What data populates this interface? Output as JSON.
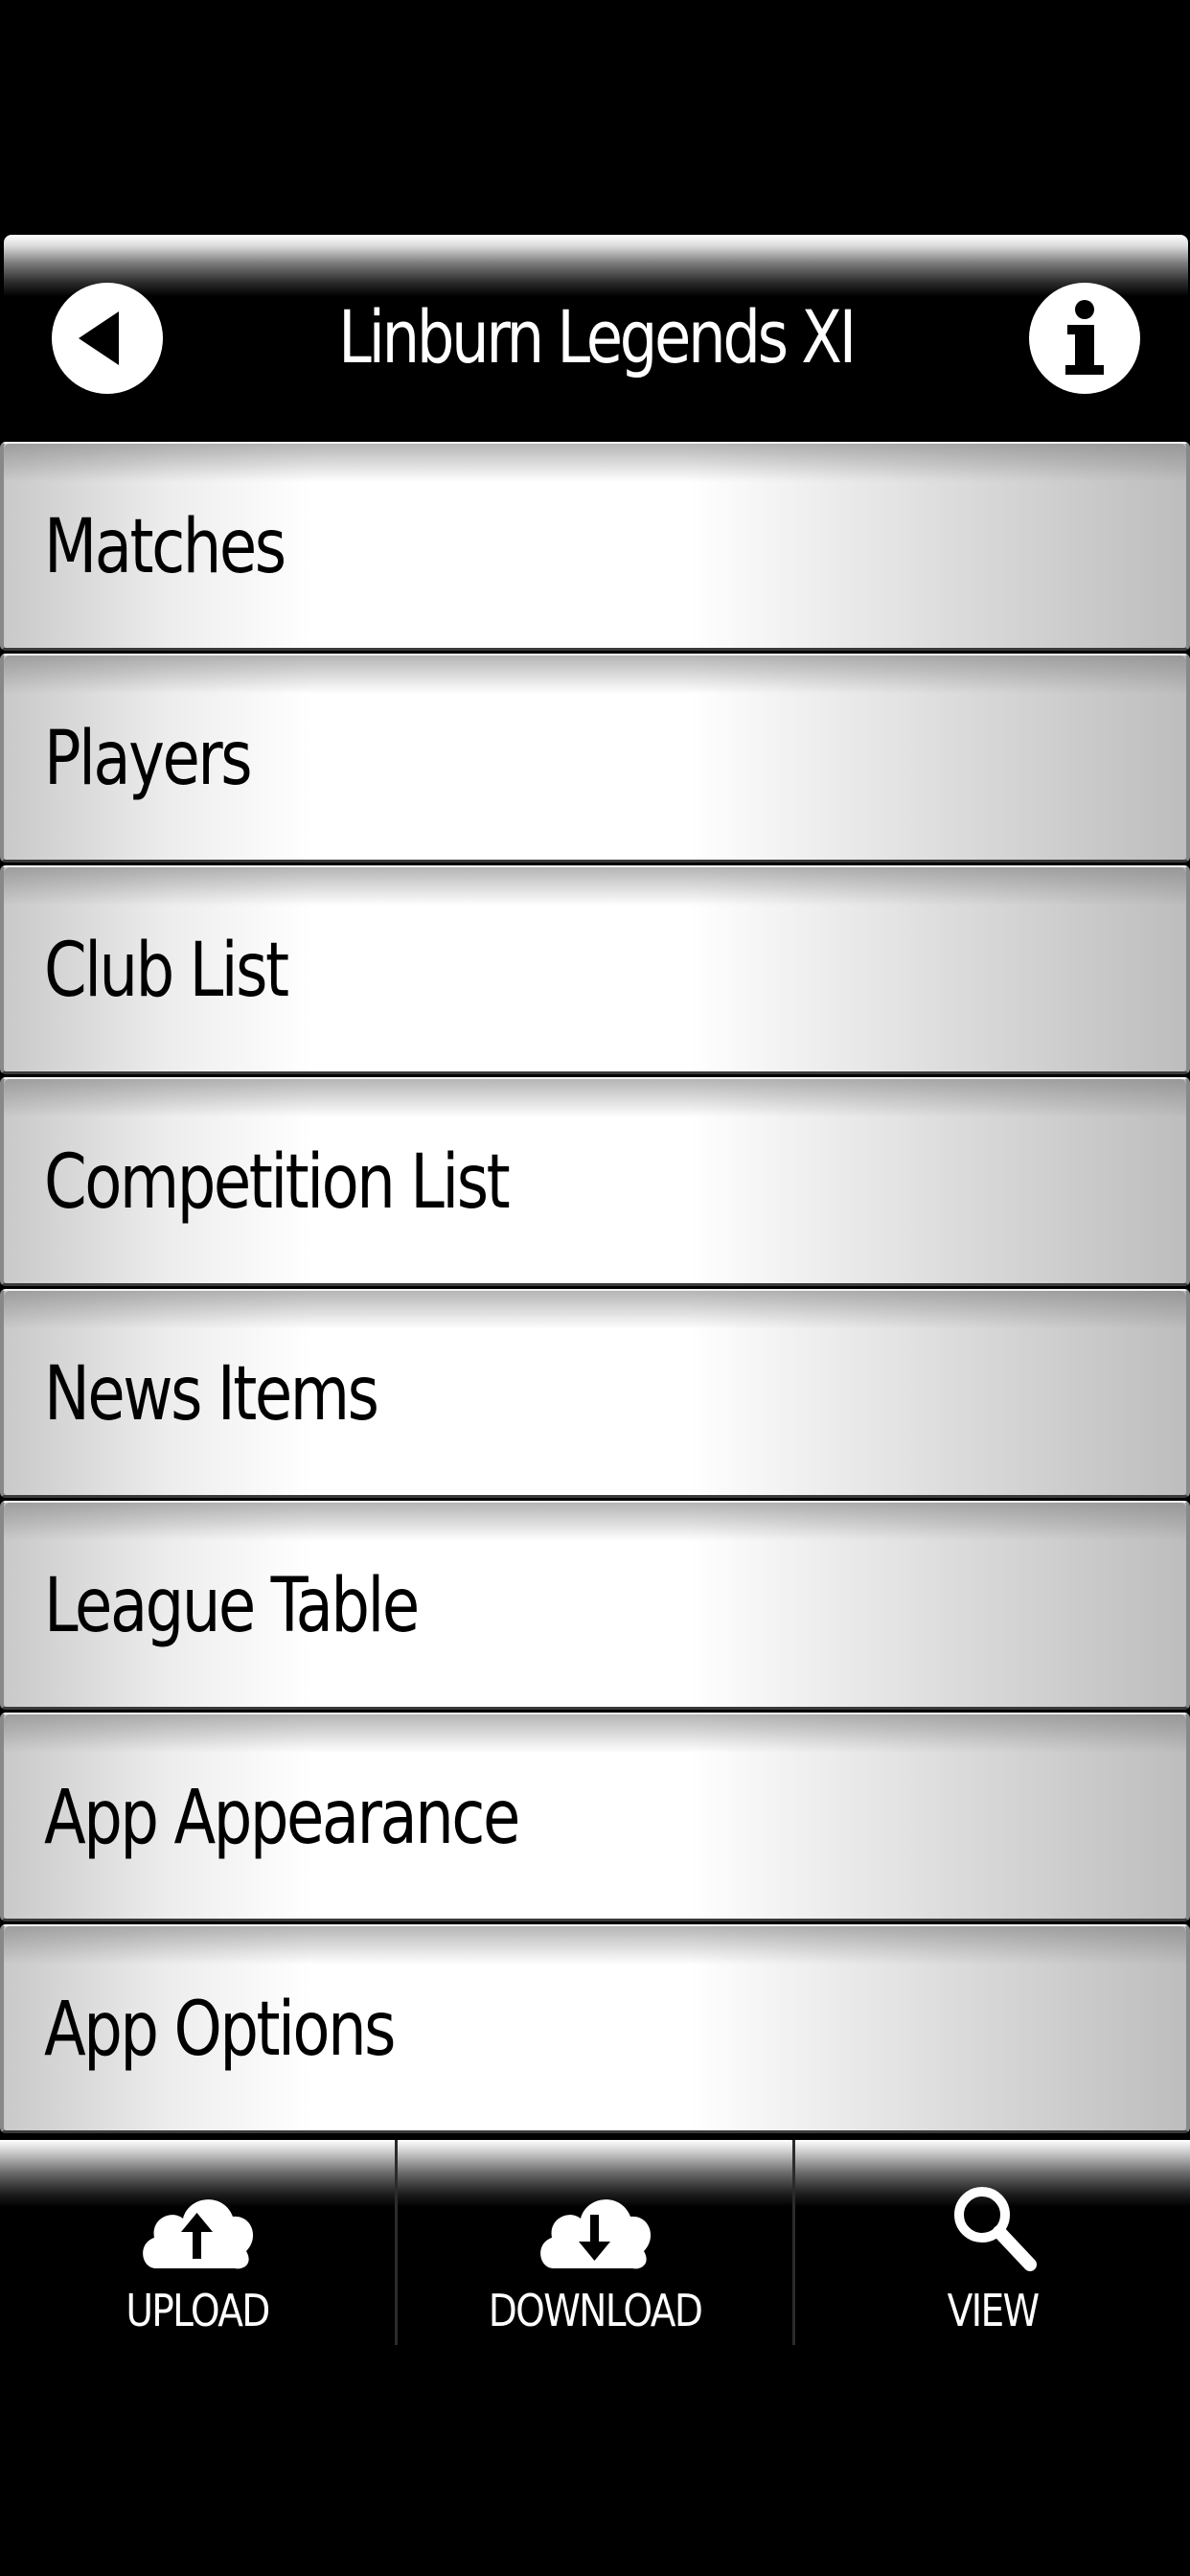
{
  "header": {
    "title": "Linburn Legends XI",
    "back_icon": "back-arrow-icon",
    "info_icon": "info-icon"
  },
  "menu": {
    "items": [
      {
        "label": "Matches"
      },
      {
        "label": "Players"
      },
      {
        "label": "Club List"
      },
      {
        "label": "Competition List"
      },
      {
        "label": "News Items"
      },
      {
        "label": "League Table"
      },
      {
        "label": "App Appearance"
      },
      {
        "label": "App Options"
      }
    ]
  },
  "toolbar": {
    "upload_label": "UPLOAD",
    "download_label": "DOWNLOAD",
    "view_label": "VIEW",
    "upload_icon": "cloud-upload-icon",
    "download_icon": "cloud-download-icon",
    "view_icon": "search-icon"
  },
  "colors": {
    "background": "#000000",
    "text_light": "#ffffff",
    "text_dark": "#000000"
  }
}
